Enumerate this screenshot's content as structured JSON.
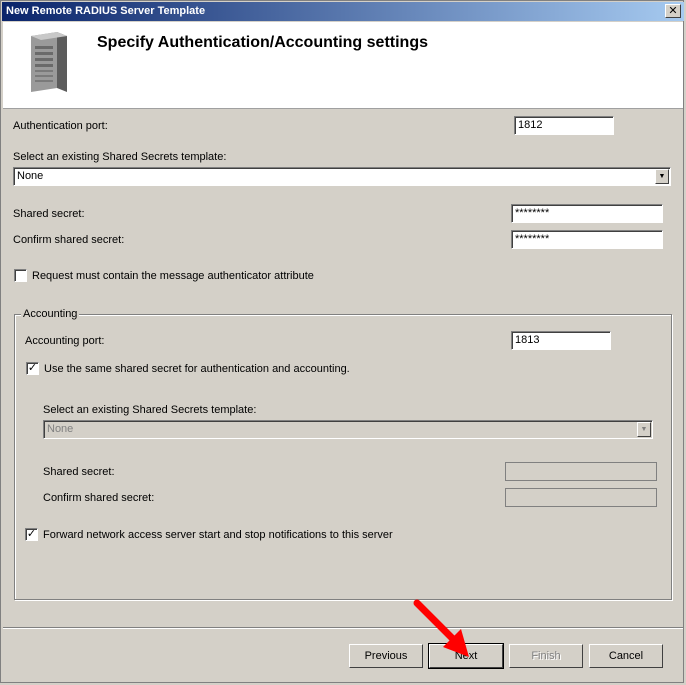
{
  "window": {
    "title": "New Remote RADIUS Server Template",
    "close_glyph": "✕"
  },
  "header": {
    "heading": "Specify Authentication/Accounting settings",
    "icon": "server-icon"
  },
  "auth": {
    "port_label": "Authentication port:",
    "port_value": "1812",
    "template_label": "Select an existing Shared Secrets template:",
    "template_value": "None",
    "secret_label": "Shared secret:",
    "secret_value": "********",
    "confirm_label": "Confirm shared secret:",
    "confirm_value": "********",
    "authenticator_label": "Request must contain the message authenticator attribute",
    "authenticator_checked": false
  },
  "accounting": {
    "group_label": "Accounting",
    "port_label": "Accounting port:",
    "port_value": "1813",
    "same_secret_label": "Use the same shared secret for authentication and accounting.",
    "same_secret_checked": true,
    "template_label": "Select an existing Shared Secrets template:",
    "template_value": "None",
    "secret_label": "Shared secret:",
    "confirm_label": "Confirm shared secret:",
    "forward_label": "Forward network access server start and stop notifications to this server",
    "forward_checked": true
  },
  "buttons": {
    "previous": "Previous",
    "next": "Next",
    "finish": "Finish",
    "cancel": "Cancel"
  },
  "colors": {
    "titlebar": "#0a246a",
    "dialog_bg": "#d4d0c8",
    "arrow": "#ff0000"
  }
}
